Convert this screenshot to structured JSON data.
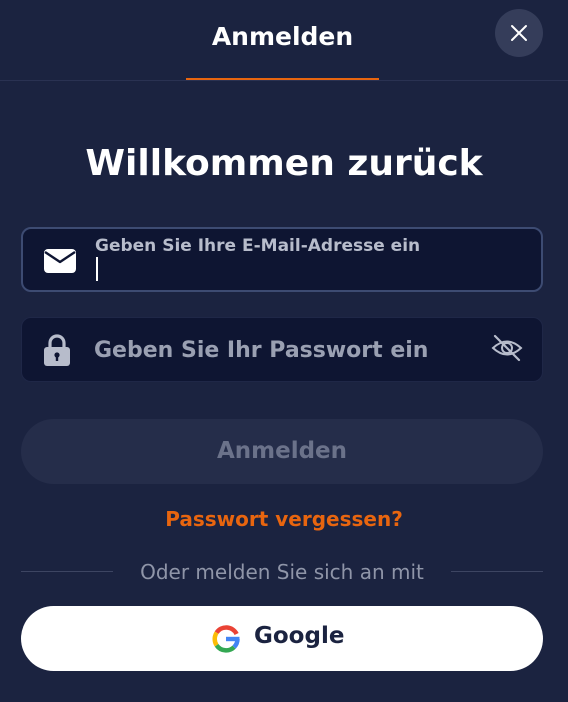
{
  "header": {
    "tab_label": "Anmelden",
    "accent_color": "#e8650f"
  },
  "close_icon": "close-icon",
  "welcome_title": "Willkommen zurück",
  "email_field": {
    "icon": "envelope-icon",
    "label": "Geben Sie Ihre E-Mail-Adresse ein",
    "value": ""
  },
  "password_field": {
    "icon": "lock-icon",
    "placeholder": "Geben Sie Ihr Passwort ein",
    "toggle_icon": "eye-off-icon"
  },
  "submit_label": "Anmelden",
  "forgot_password": "Passwort vergessen?",
  "divider_text": "Oder melden Sie sich an mit",
  "google_button": {
    "icon": "google-icon",
    "label": "Google"
  }
}
